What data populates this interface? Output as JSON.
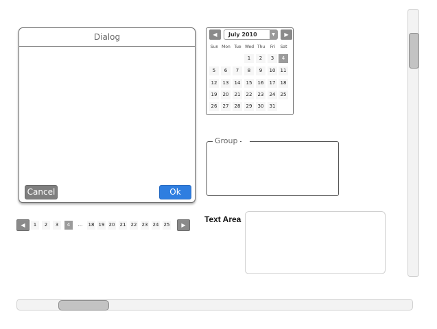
{
  "dialog": {
    "title": "Dialog",
    "cancel_label": "Cancel",
    "ok_label": "Ok"
  },
  "calendar": {
    "month_label": "July 2010",
    "prev_icon": "◀",
    "next_icon": "▶",
    "dropdown_icon": "▼",
    "weekdays": [
      "Sun",
      "Mon",
      "Tue",
      "Wed",
      "Thu",
      "Fri",
      "Sat"
    ],
    "weeks": [
      [
        "",
        "",
        "",
        "1",
        "2",
        "3",
        "4"
      ],
      [
        "5",
        "6",
        "7",
        "8",
        "9",
        "10",
        "11"
      ],
      [
        "12",
        "13",
        "14",
        "15",
        "16",
        "17",
        "18"
      ],
      [
        "19",
        "20",
        "21",
        "22",
        "23",
        "24",
        "25"
      ],
      [
        "26",
        "27",
        "28",
        "29",
        "30",
        "31",
        ""
      ]
    ],
    "selected_day": "4"
  },
  "group": {
    "label": "Group"
  },
  "pagination": {
    "prev_icon": "◀",
    "next_icon": "▶",
    "pages": [
      "1",
      "2",
      "3",
      "4",
      "...",
      "18",
      "19",
      "20",
      "21",
      "22",
      "23",
      "24",
      "25"
    ],
    "current_page": "4"
  },
  "text_area": {
    "label": "Text Area",
    "value": ""
  },
  "scrollbars": {
    "vertical_position": 0.1,
    "horizontal_position": 0.12
  }
}
